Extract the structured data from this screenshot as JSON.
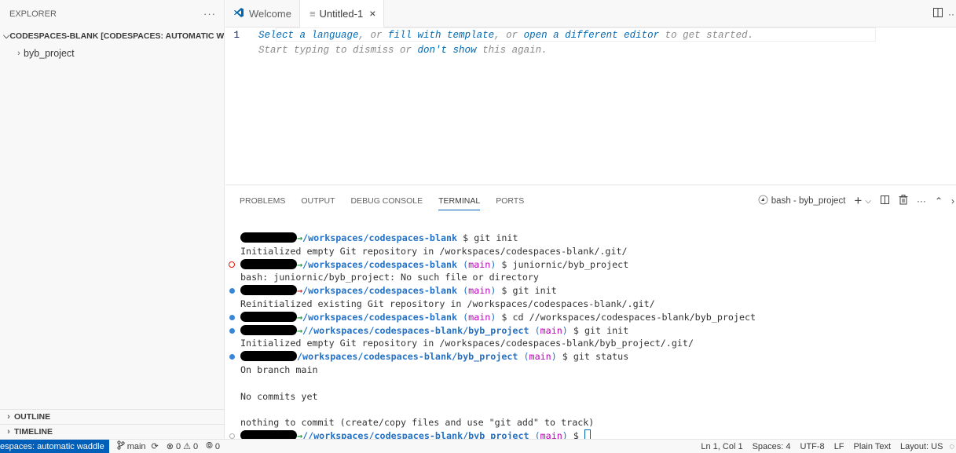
{
  "sidebar": {
    "title": "EXPLORER",
    "more_icon": "ellipsis-icon",
    "workspace": "CODESPACES-BLANK [CODESPACES: AUTOMATIC W...",
    "folder": "byb_project",
    "outline": "OUTLINE",
    "timeline": "TIMELINE"
  },
  "tabs": [
    {
      "label": "Welcome",
      "icon": "vscode-icon"
    },
    {
      "label": "Untitled-1",
      "icon": "file-lines-icon",
      "close": "×"
    }
  ],
  "editor": {
    "line_number": "1",
    "hint_part1": "Select a language",
    "hint_part2": ", or ",
    "hint_part3": "fill with template",
    "hint_part4": ", or ",
    "hint_part5": "open a different editor",
    "hint_part6": " to get started.",
    "hint2_part1": "Start typing to dismiss or ",
    "hint2_part2": "don't show",
    "hint2_part3": " this again."
  },
  "panel": {
    "tabs": [
      "PROBLEMS",
      "OUTPUT",
      "DEBUG CONSOLE",
      "TERMINAL",
      "PORTS"
    ],
    "active_tab": "TERMINAL",
    "shell_label": "bash - byb_project"
  },
  "terminal": {
    "lines": [
      {
        "type": "prompt",
        "deco": "",
        "arrow": "ok",
        "path": "/workspaces/codespaces-blank",
        "branch": "",
        "cmd": " $ git init"
      },
      {
        "type": "out",
        "text": "Initialized empty Git repository in /workspaces/codespaces-blank/.git/"
      },
      {
        "type": "prompt",
        "deco": "err",
        "arrow": "ok",
        "path": "/workspaces/codespaces-blank",
        "branch": "main",
        "cmd": " $ juniornic/byb_project"
      },
      {
        "type": "out",
        "text": "bash: juniornic/byb_project: No such file or directory"
      },
      {
        "type": "prompt",
        "deco": "ok",
        "arrow": "err",
        "path": "/workspaces/codespaces-blank",
        "branch": "main",
        "cmd": " $ git init"
      },
      {
        "type": "out",
        "text": "Reinitialized existing Git repository in /workspaces/codespaces-blank/.git/"
      },
      {
        "type": "prompt",
        "deco": "ok",
        "arrow": "ok",
        "path": "/workspaces/codespaces-blank",
        "branch": "main",
        "cmd": " $ cd //workspaces/codespaces-blank/byb_project"
      },
      {
        "type": "prompt",
        "deco": "ok",
        "arrow": "ok",
        "path": "//workspaces/codespaces-blank/byb_project",
        "branch": "main",
        "cmd": " $ git init"
      },
      {
        "type": "out",
        "text": "Initialized empty Git repository in /workspaces/codespaces-blank/byb_project/.git/"
      },
      {
        "type": "prompt",
        "deco": "ok",
        "arrow": "none",
        "path": "/workspaces/codespaces-blank/byb_project",
        "branch": "main",
        "cmd": " $ git status"
      },
      {
        "type": "out",
        "text": "On branch main"
      },
      {
        "type": "out",
        "text": ""
      },
      {
        "type": "out",
        "text": "No commits yet"
      },
      {
        "type": "out",
        "text": ""
      },
      {
        "type": "out",
        "text": "nothing to commit (create/copy files and use \"git add\" to track)"
      },
      {
        "type": "prompt",
        "deco": "none",
        "arrow": "ok",
        "path": "//workspaces/codespaces-blank/byb_project",
        "branch": "main",
        "cmd": " $ ",
        "cursor": true
      }
    ]
  },
  "status": {
    "remote": "espaces: automatic waddle",
    "branch": "main",
    "errors": "0",
    "warnings": "0",
    "ports": "0",
    "position": "Ln 1, Col 1",
    "spaces": "Spaces: 4",
    "encoding": "UTF-8",
    "eol": "LF",
    "language": "Plain Text",
    "layout": "Layout: US"
  },
  "colors": {
    "accent": "#005fb8",
    "path": "#2472c8",
    "branch": "#bc05bc",
    "arrow_ok": "#1e9e3a",
    "arrow_err": "#cd3131"
  }
}
